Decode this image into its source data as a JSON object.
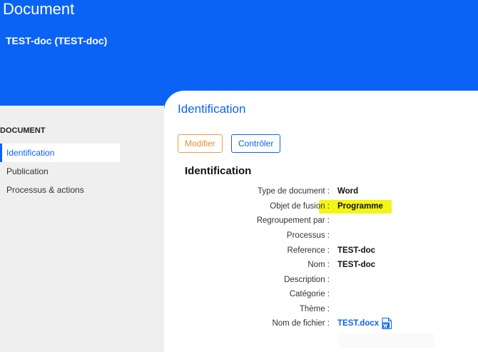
{
  "header": {
    "app_title": "Document",
    "doc_title": "TEST-doc (TEST-doc)"
  },
  "sidebar": {
    "heading": "DOCUMENT",
    "items": [
      {
        "label": "Identification",
        "active": true
      },
      {
        "label": "Publication",
        "active": false
      },
      {
        "label": "Processus & actions",
        "active": false
      }
    ]
  },
  "main": {
    "section_title": "Identification",
    "buttons": {
      "modifier": "Modifier",
      "controler": "Contrôler"
    },
    "subheading": "Identification",
    "fields": [
      {
        "label": "Type de document :",
        "value": "Word"
      },
      {
        "label": "Objet de fusion :",
        "value": "Programme"
      },
      {
        "label": "Regroupement par :",
        "value": ""
      },
      {
        "label": "Processus :",
        "value": ""
      },
      {
        "label": "Reference :",
        "value": "TEST-doc"
      },
      {
        "label": "Nom :",
        "value": "TEST-doc"
      },
      {
        "label": "Description :",
        "value": ""
      },
      {
        "label": "Catégorie :",
        "value": ""
      },
      {
        "label": "Thème :",
        "value": ""
      },
      {
        "label": "Nom de fichier :",
        "value": "TEST.docx"
      }
    ],
    "file_icon": "word-file-icon"
  },
  "colors": {
    "primary": "#0a63f5",
    "modify_button": "#f08a30",
    "sidebar_bg": "#efefef",
    "highlight": "#f3f514"
  }
}
